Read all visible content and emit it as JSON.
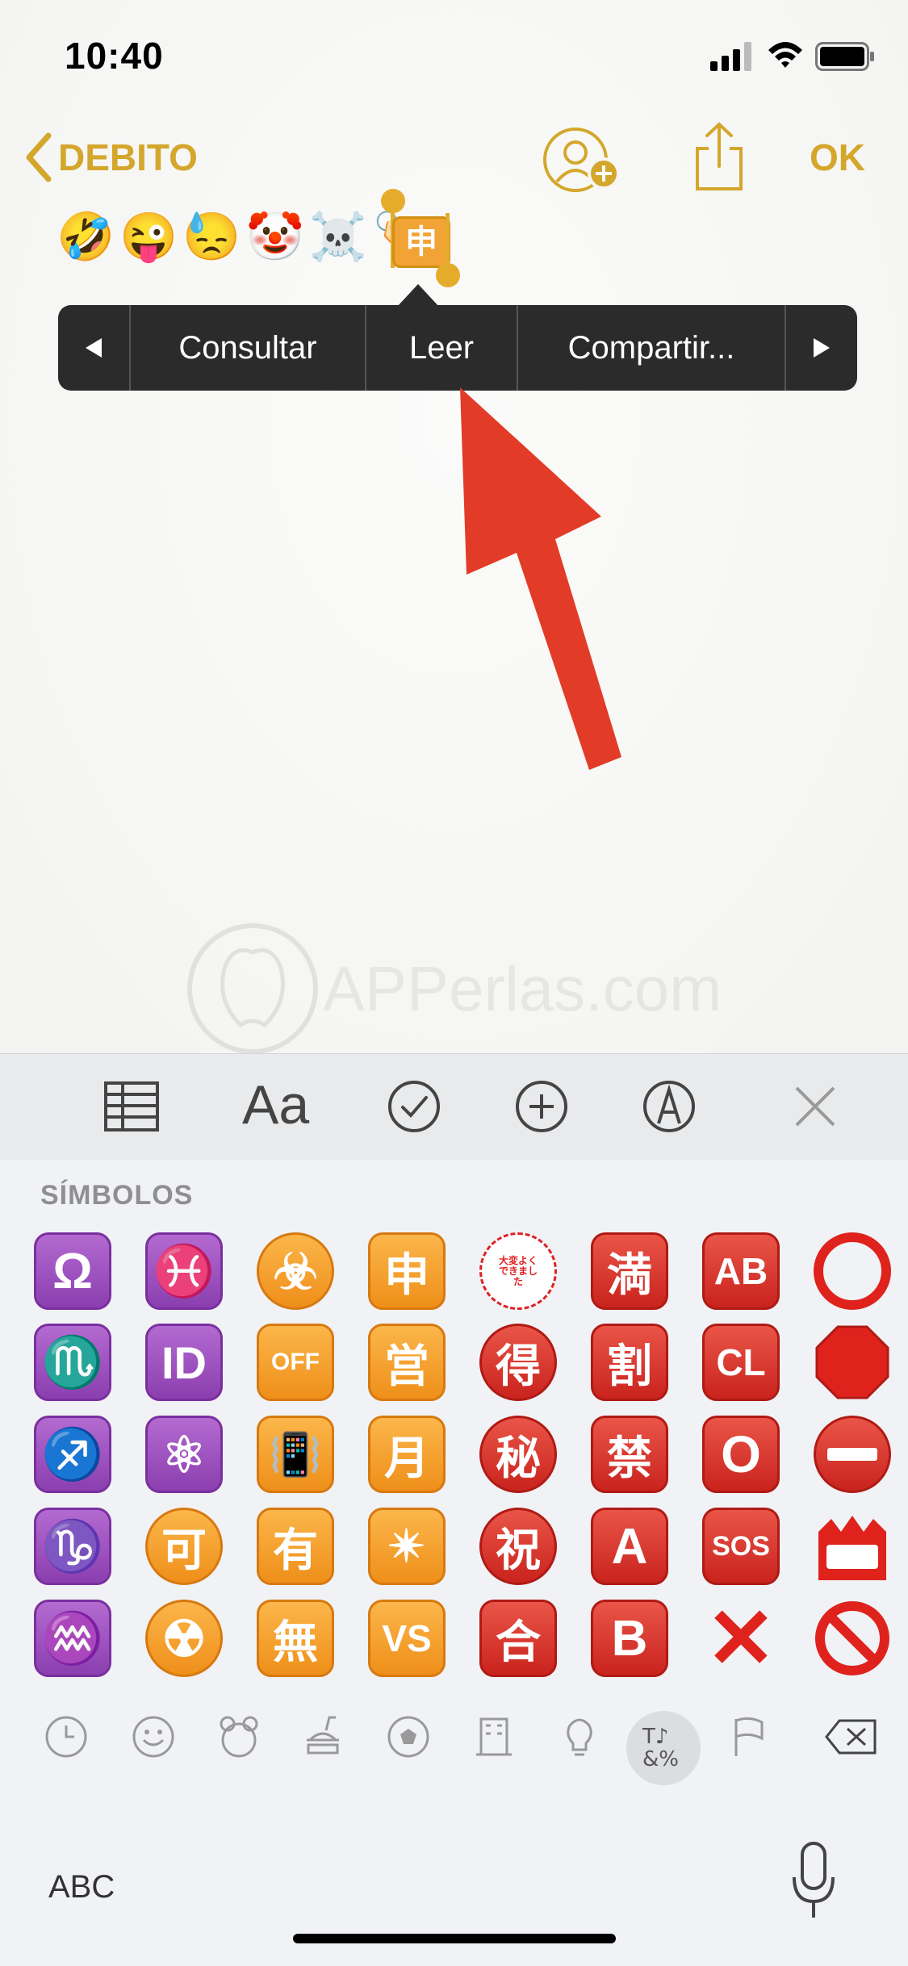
{
  "status": {
    "time": "10:40"
  },
  "nav": {
    "back_label": "DEBITO",
    "ok_label": "OK"
  },
  "note": {
    "emoji_text": "🤣😜😓🤡☠️🏷️",
    "selected_char": "申"
  },
  "context_menu": {
    "items": [
      "Consultar",
      "Leer",
      "Compartir..."
    ]
  },
  "watermark": {
    "text": "APPerlas.com"
  },
  "toolbar": {
    "format_label": "Aa"
  },
  "keyboard": {
    "section_title": "SÍMBOLOS",
    "grid": [
      [
        "♎︎",
        "申",
        "㊗",
        "満",
        "AB",
        "⭕"
      ],
      [],
      [],
      [],
      []
    ],
    "symbols": {
      "c0": [
        "Ω",
        "♏",
        "♐",
        "♑",
        "♒"
      ],
      "c1": [
        "♓",
        "ID",
        "⚛",
        "可",
        "☢"
      ],
      "c2": [
        "☣",
        "OFF",
        "📳",
        "有",
        "無"
      ],
      "c3": [
        "申",
        "営",
        "月",
        "✴",
        "VS"
      ],
      "c4": [
        "大変よくできました",
        "得",
        "秘",
        "祝",
        "合"
      ],
      "c5": [
        "満",
        "割",
        "禁",
        "A",
        "B"
      ],
      "c6": [
        "AB",
        "CL",
        "O",
        "SOS",
        "✕"
      ],
      "c7": [
        "⭕",
        "🛑",
        "⛔",
        "📛",
        "🚫"
      ]
    },
    "abc_label": "ABC"
  },
  "colors": {
    "accent": "#d4a72c",
    "arrow": "#e23b27"
  }
}
